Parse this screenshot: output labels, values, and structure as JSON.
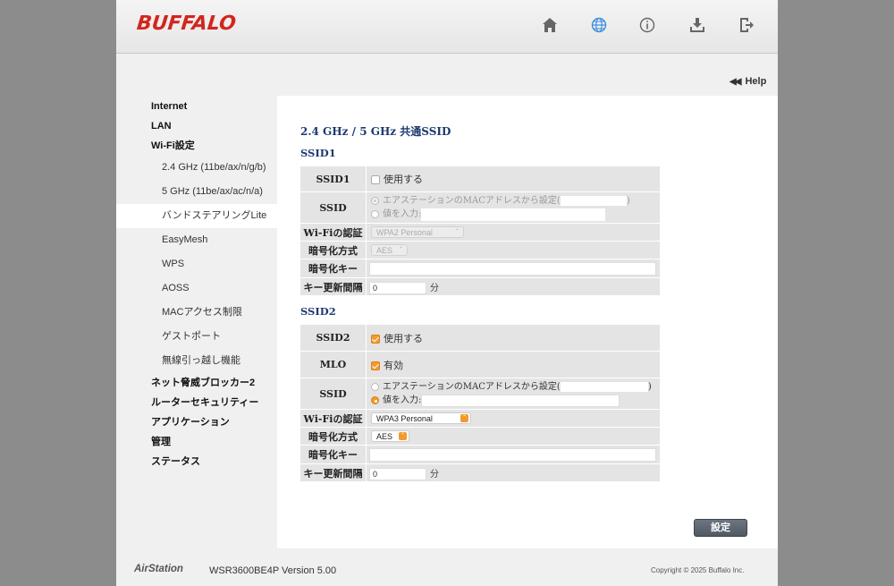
{
  "header": {
    "logo": "BUFFALO",
    "icons": [
      "home-icon",
      "globe-icon",
      "info-icon",
      "download-icon",
      "logout-icon"
    ],
    "help_label": "Help"
  },
  "sidebar": {
    "items": [
      {
        "label": "Internet",
        "level": "top"
      },
      {
        "label": "LAN",
        "level": "top"
      },
      {
        "label": "Wi-Fi設定",
        "level": "top"
      },
      {
        "label": "2.4 GHz (11be/ax/n/g/b)",
        "level": "sub"
      },
      {
        "label": "5 GHz (11be/ax/ac/n/a)",
        "level": "sub"
      },
      {
        "label": "バンドステアリングLite",
        "level": "sub",
        "active": true
      },
      {
        "label": "EasyMesh",
        "level": "sub"
      },
      {
        "label": "WPS",
        "level": "sub"
      },
      {
        "label": "AOSS",
        "level": "sub"
      },
      {
        "label": "MACアクセス制限",
        "level": "sub"
      },
      {
        "label": "ゲストポート",
        "level": "sub"
      },
      {
        "label": "無線引っ越し機能",
        "level": "sub"
      },
      {
        "label": "ネット脅威ブロッカー2",
        "level": "top"
      },
      {
        "label": "ルーターセキュリティー",
        "level": "top"
      },
      {
        "label": "アプリケーション",
        "level": "top"
      },
      {
        "label": "管理",
        "level": "top"
      },
      {
        "label": "ステータス",
        "level": "top"
      }
    ]
  },
  "main": {
    "title": "2.4 GHz / 5 GHz 共通SSID",
    "ssid1": {
      "heading": "SSID1",
      "rows": {
        "enable_label": "SSID1",
        "enable_text": "使用する",
        "enable_checked": false,
        "ssid_label": "SSID",
        "ssid_mac_option": "エアステーションのMACアドレスから設定(",
        "ssid_mac_close": ")",
        "ssid_input_option": "値を入力:",
        "auth_label": "Wi-Fiの認証",
        "auth_value": "WPA2 Personal",
        "enc_label": "暗号化方式",
        "enc_value": "AES",
        "key_label": "暗号化キー",
        "key_value": "",
        "interval_label": "キー更新間隔",
        "interval_value": "0",
        "interval_unit": "分"
      }
    },
    "ssid2": {
      "heading": "SSID2",
      "rows": {
        "enable_label": "SSID2",
        "enable_text": "使用する",
        "enable_checked": true,
        "mlo_label": "MLO",
        "mlo_text": "有効",
        "mlo_checked": true,
        "ssid_label": "SSID",
        "ssid_mac_option": "エアステーションのMACアドレスから設定(",
        "ssid_mac_close": ")",
        "ssid_input_option": "値を入力:",
        "auth_label": "Wi-Fiの認証",
        "auth_value": "WPA3 Personal",
        "enc_label": "暗号化方式",
        "enc_value": "AES",
        "key_label": "暗号化キー",
        "key_value": "",
        "interval_label": "キー更新間隔",
        "interval_value": "0",
        "interval_unit": "分"
      }
    },
    "apply_label": "設定"
  },
  "footer": {
    "brand": "AirStation",
    "model": "WSR3600BE4P",
    "version": "Version 5.00",
    "copyright": "Copyright © 2025 Buffalo Inc."
  },
  "colors": {
    "brand_red": "#d2261e",
    "accent_orange": "#f29a2e",
    "heading_navy": "#1c3a6e"
  }
}
